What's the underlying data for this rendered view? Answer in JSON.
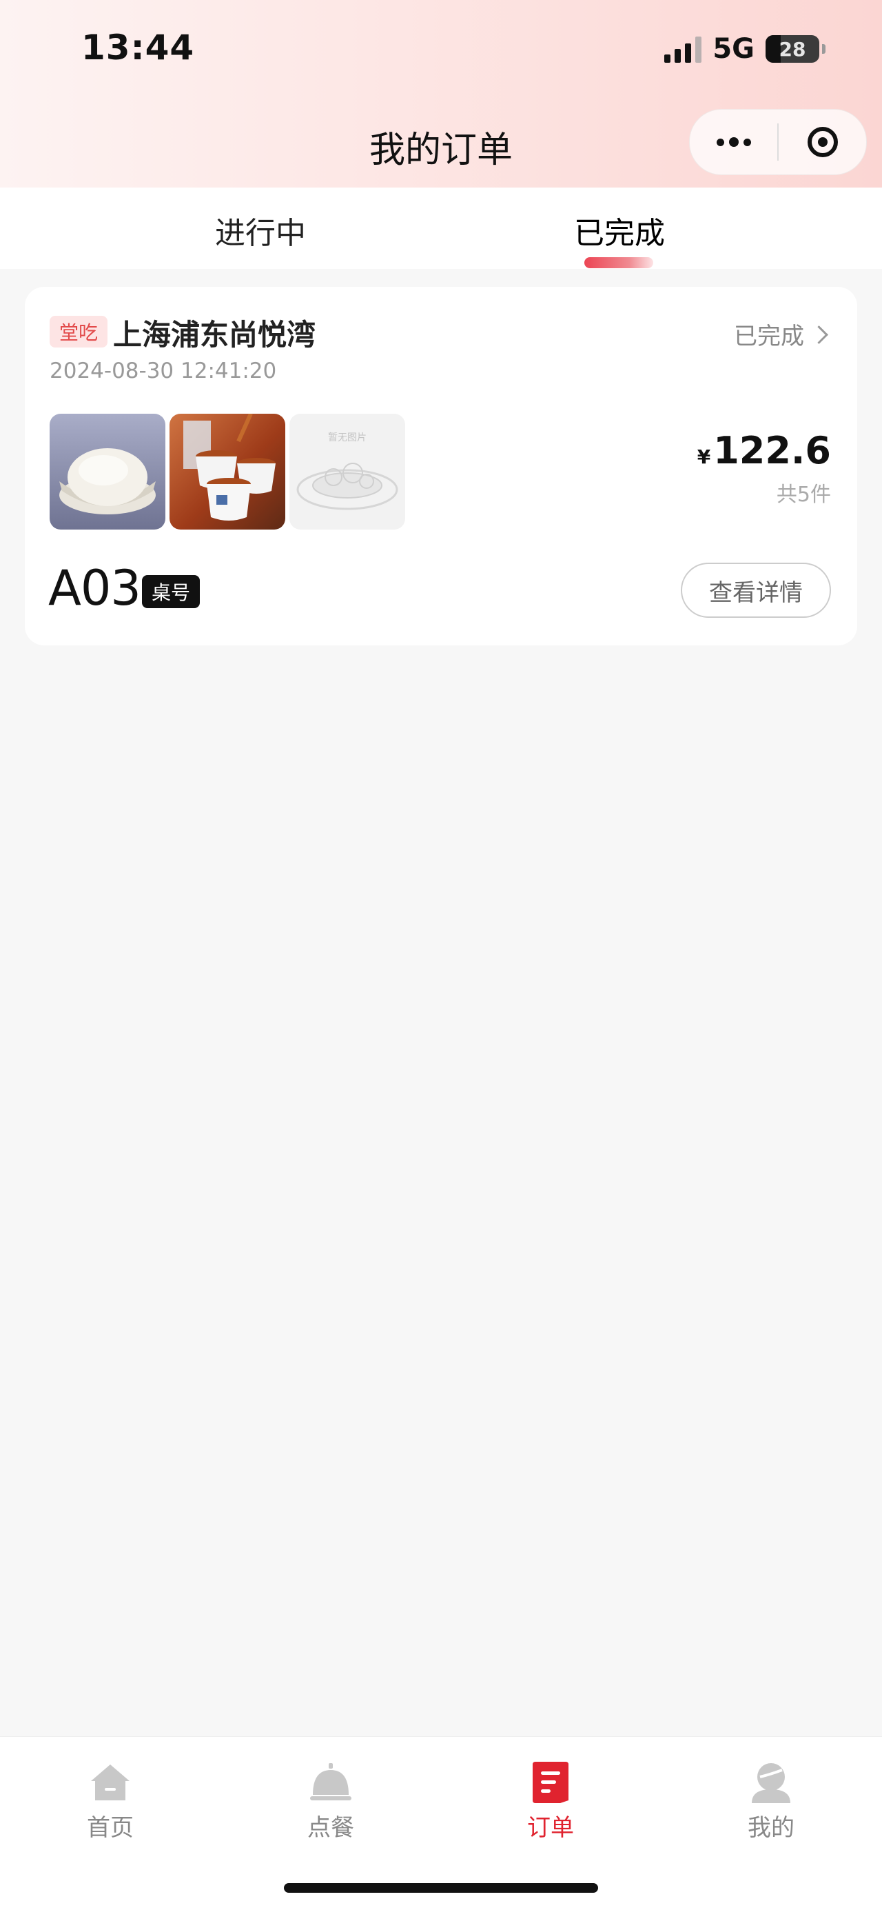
{
  "status_bar": {
    "time": "13:44",
    "network": "5G",
    "battery": "28"
  },
  "nav": {
    "title": "我的订单"
  },
  "tabs": [
    {
      "label": "进行中"
    },
    {
      "label": "已完成"
    }
  ],
  "order": {
    "tag": "堂吃",
    "store": "上海浦东尚悦湾",
    "status": "已完成",
    "datetime": "2024-08-30 12:41:20",
    "placeholder_image_label": "暂无图片",
    "currency": "¥",
    "total": "122.6",
    "count": "共5件",
    "table_number": "A03",
    "table_badge": "桌号",
    "detail_button": "查看详情"
  },
  "tabbar": [
    {
      "label": "首页",
      "icon": "home-icon"
    },
    {
      "label": "点餐",
      "icon": "service-bell-icon"
    },
    {
      "label": "订单",
      "icon": "order-icon"
    },
    {
      "label": "我的",
      "icon": "user-icon"
    }
  ],
  "colors": {
    "accent": "#e0232f",
    "tag_bg": "#fde4e4",
    "tag_text": "#e24a4a",
    "inactive": "#c8c8c8"
  }
}
